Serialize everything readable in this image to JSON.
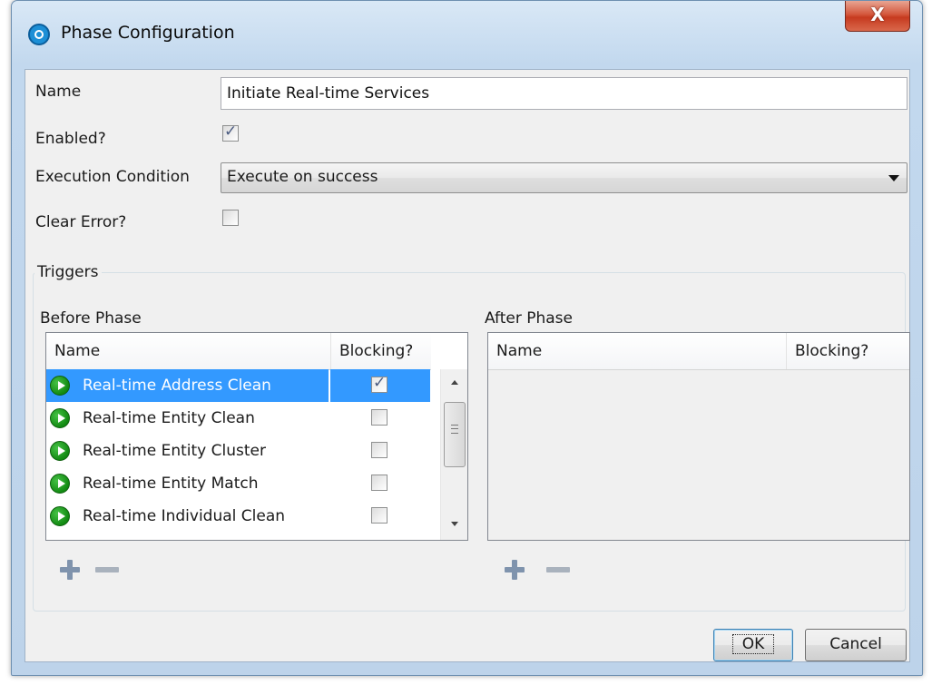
{
  "window": {
    "title": "Phase Configuration",
    "close_label": "X"
  },
  "form": {
    "name_label": "Name",
    "name_value": "Initiate Real-time Services",
    "enabled_label": "Enabled?",
    "enabled_checked": true,
    "execution_label": "Execution Condition",
    "execution_value": "Execute on success",
    "clear_error_label": "Clear Error?",
    "clear_error_checked": false
  },
  "triggers": {
    "group_label": "Triggers",
    "before": {
      "label": "Before Phase",
      "columns": [
        "Name",
        "Blocking?"
      ],
      "rows": [
        {
          "name": "Real-time Address Clean",
          "blocking": true,
          "selected": true
        },
        {
          "name": "Real-time Entity Clean",
          "blocking": false,
          "selected": false
        },
        {
          "name": "Real-time Entity Cluster",
          "blocking": false,
          "selected": false
        },
        {
          "name": "Real-time Entity Match",
          "blocking": false,
          "selected": false
        },
        {
          "name": "Real-time Individual Clean",
          "blocking": false,
          "selected": false
        }
      ]
    },
    "after": {
      "label": "After Phase",
      "columns": [
        "Name",
        "Blocking?"
      ],
      "rows": []
    }
  },
  "buttons": {
    "ok": "OK",
    "cancel": "Cancel"
  },
  "icons": {
    "app": "app-logo-icon",
    "row": "play-icon",
    "add": "plus-icon",
    "remove": "minus-icon"
  }
}
